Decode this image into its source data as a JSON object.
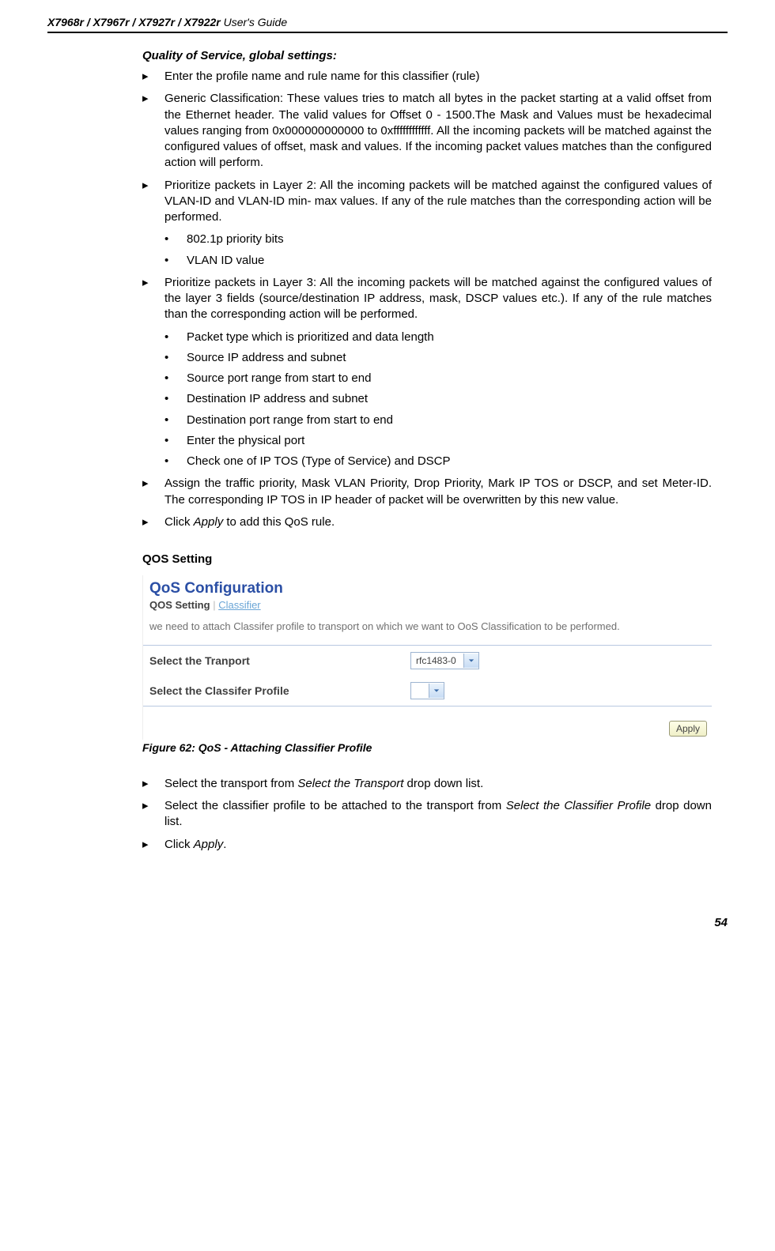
{
  "header": {
    "models": "X7968r / X7967r / X7927r / X7922r",
    "suffix": " User's Guide"
  },
  "subtitle": "Quality of Service, global settings:",
  "items": [
    "Enter the profile name and rule name for this classifier (rule)",
    "Generic Classification: These values tries to match all bytes in the packet starting at a valid offset from the Ethernet header. The valid values for Offset 0 - 1500.The Mask and Values must be hexadecimal values ranging from 0x000000000000 to 0xffffffffffff. All the incoming packets will be matched against the configured values of offset, mask and values. If the incoming packet values matches than the configured action will perform.",
    "Prioritize packets in Layer 2: All the incoming packets will be matched against the configured values of VLAN-ID and VLAN-ID min- max values. If any of the rule matches than the corresponding action will be performed."
  ],
  "sub1": [
    "802.1p priority bits",
    "VLAN ID value"
  ],
  "item4": "Prioritize packets in Layer 3: All the incoming packets will be matched against the configured values of the layer 3 fields (source/destination IP address, mask, DSCP values etc.). If any of the rule matches than the corresponding action will be performed.",
  "sub2": [
    "Packet type which is prioritized and data length",
    "Source IP address and subnet",
    "Source port range from start to end",
    "Destination IP address and subnet",
    "Destination port range from start to end",
    "Enter the physical port",
    "Check one of IP TOS (Type of Service) and DSCP"
  ],
  "item5": "Assign the traffic priority, Mask VLAN Priority, Drop Priority, Mark IP TOS or DSCP, and set Meter-ID. The corresponding IP TOS in IP header of packet will be overwritten by this new value.",
  "item6_pre": "Click ",
  "item6_em": "Apply",
  "item6_post": " to add this QoS rule.",
  "heading2": "QOS Setting",
  "figure": {
    "title": "QoS Configuration",
    "tab_active": "QOS Setting",
    "tab_link": "Classifier",
    "desc": "we need to attach Classifer profile to transport on which we want to OoS Classification to be performed.",
    "row1_label": "Select the Tranport",
    "row1_value": "rfc1483-0",
    "row2_label": "Select the Classifer Profile",
    "apply": "Apply"
  },
  "caption": "Figure 62: QoS - Attaching Classifier Profile",
  "step1_pre": "Select the transport from ",
  "step1_em": "Select the Transport",
  "step1_post": " drop down list.",
  "step2_pre": "Select the classifier profile to be attached to the transport from ",
  "step2_em": "Select the Classifier Profile",
  "step2_post": " drop down list.",
  "step3_pre": "Click ",
  "step3_em": "Apply",
  "step3_post": ".",
  "page_num": "54"
}
